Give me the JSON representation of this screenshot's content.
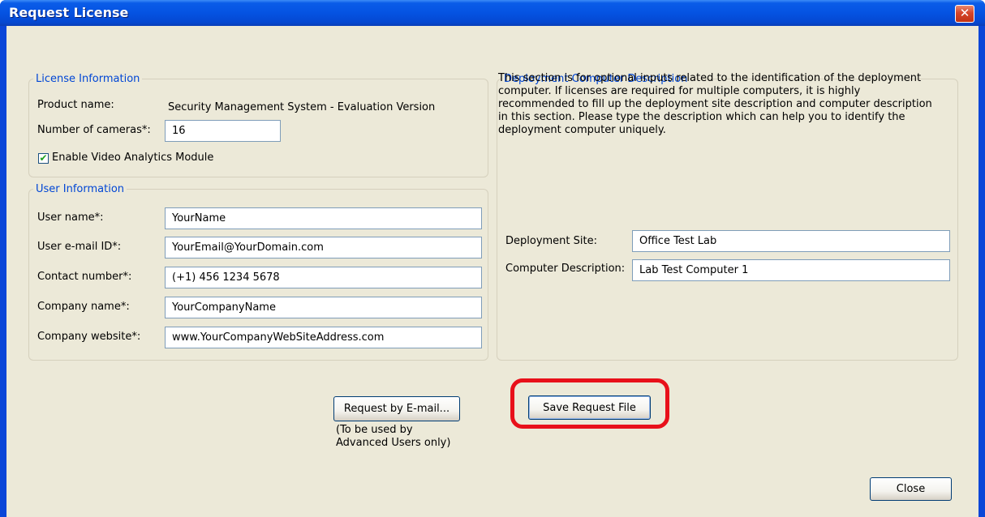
{
  "window": {
    "title": "Request License",
    "close_glyph": "✕"
  },
  "license_info": {
    "legend": "License Information",
    "product_name_label": "Product name:",
    "product_name_value": "Security Management System - Evaluation Version",
    "cameras_label": "Number of cameras*:",
    "cameras_value": "16",
    "video_analytics_label": "Enable Video Analytics Module",
    "video_analytics_checked": true,
    "check_glyph": "✔"
  },
  "user_info": {
    "legend": "User Information",
    "fields": [
      {
        "label": "User name*:",
        "value": "YourName"
      },
      {
        "label": "User e-mail ID*:",
        "value": "YourEmail@YourDomain.com"
      },
      {
        "label": "Contact number*:",
        "value": "(+1) 456 1234 5678"
      },
      {
        "label": "Company name*:",
        "value": "YourCompanyName"
      },
      {
        "label": "Company website*:",
        "value": "www.YourCompanyWebSiteAddress.com"
      }
    ]
  },
  "deployment": {
    "legend": "Deployment Computer Description",
    "description_lines": [
      "This section is for optional inputs related to the identification of the deployment",
      "computer. If licenses are required for multiple computers, it is highly",
      "recommended to fill up the deployment site description and computer description",
      "in this section. Please type the description which can help you to identify the",
      "deployment computer uniquely."
    ],
    "site_label": "Deployment Site:",
    "site_value": "Office Test Lab",
    "computer_label": "Computer Description:",
    "computer_value": "Lab Test Computer 1"
  },
  "actions": {
    "request_email_label": "Request by E-mail...",
    "request_email_note_lines": [
      "(To be used by",
      "Advanced Users only)"
    ],
    "save_request_label": "Save Request File",
    "close_label": "Close"
  },
  "colors": {
    "titlebar": "#0553e2",
    "client_bg": "#ece9d8",
    "legend_text": "#0046d5",
    "highlight_ring": "#e8101a"
  },
  "icons": {
    "close": "close-icon",
    "check": "checkbox-check-icon"
  }
}
